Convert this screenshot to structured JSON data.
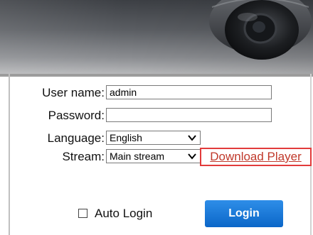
{
  "form": {
    "username_label": "User name:",
    "username_value": "admin",
    "password_label": "Password:",
    "password_value": "",
    "language_label": "Language:",
    "language_selected": "English",
    "stream_label": "Stream:",
    "stream_selected": "Main stream",
    "download_link": "Download Player",
    "auto_login_label": "Auto Login",
    "auto_login_checked": false,
    "login_button": "Login"
  },
  "colors": {
    "login_button": "#0b66c8",
    "download_link": "#c0392b",
    "highlight_box": "#e23b3b"
  },
  "icons": [
    "dome-camera-icon",
    "chevron-down-icon",
    "checkbox-icon"
  ]
}
